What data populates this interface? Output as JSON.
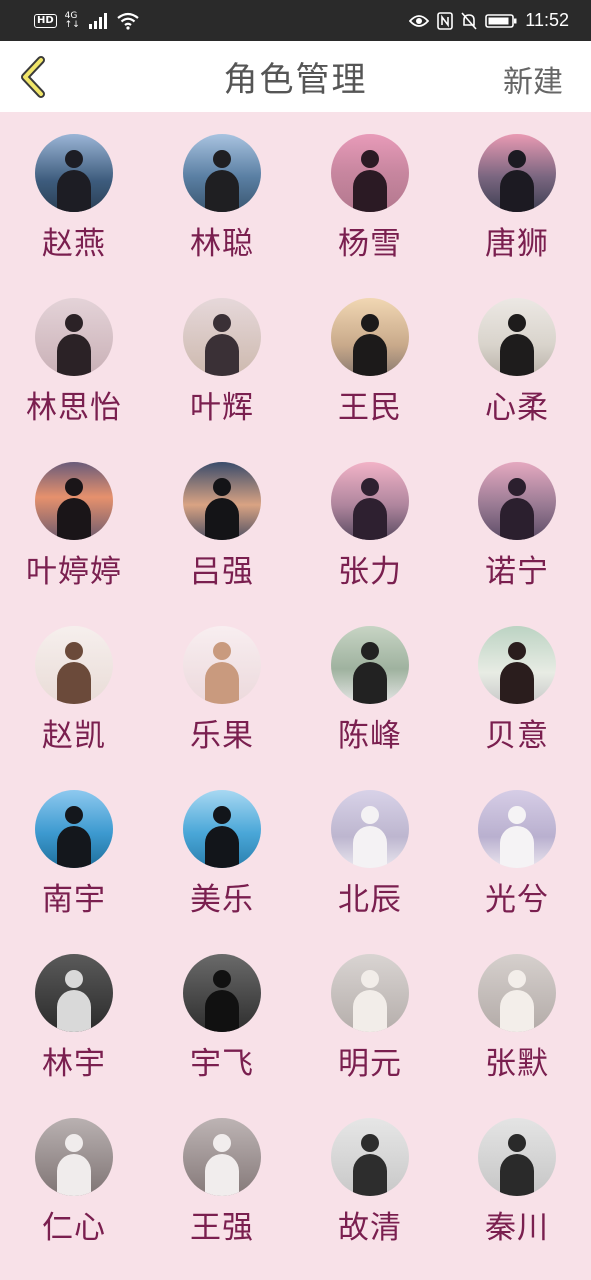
{
  "status_bar": {
    "left_badge": "HD",
    "network_top": "4G",
    "network_bottom": "↑↓",
    "time": "11:52"
  },
  "nav": {
    "title": "角色管理",
    "new_label": "新建"
  },
  "characters": [
    {
      "name": "赵燕",
      "bg": "linear-gradient(#9bb5d6,#3d5c7d 60%,#2b3f55)",
      "fg": "#1d1d24"
    },
    {
      "name": "林聪",
      "bg": "linear-gradient(#a9c3e0,#5a7fa3 55%,#3a5670)",
      "fg": "#1f1f22"
    },
    {
      "name": "杨雪",
      "bg": "linear-gradient(#e89bb9,#c7869f 50%,#b3788e)",
      "fg": "#2b1a24"
    },
    {
      "name": "唐狮",
      "bg": "linear-gradient(#e99ab3,#7a6680 55%,#3e3f52)",
      "fg": "#1c1a22"
    },
    {
      "name": "林思怡",
      "bg": "linear-gradient(#e4d3d8,#c9b0b6)",
      "fg": "#2b2226"
    },
    {
      "name": "叶辉",
      "bg": "linear-gradient(#e6d8da,#cdb9ae)",
      "fg": "#3a3036"
    },
    {
      "name": "王民",
      "bg": "linear-gradient(#f1d7b3,#c9aa8b 60%,#8a7a70)",
      "fg": "#1c1a1a"
    },
    {
      "name": "心柔",
      "bg": "linear-gradient(#ece8e4,#d9d4cc 60%,#b9b2a9)",
      "fg": "#1e1c1c"
    },
    {
      "name": "叶婷婷",
      "bg": "linear-gradient(#6a5b7a,#e6916d 45%,#6d5b6e)",
      "fg": "#1a1518"
    },
    {
      "name": "吕强",
      "bg": "linear-gradient(#3b4c6b,#d9a383 55%,#4d4f63)",
      "fg": "#141417"
    },
    {
      "name": "张力",
      "bg": "linear-gradient(#f2b3c7,#b0869e 55%,#5a4b61)",
      "fg": "#2e2030"
    },
    {
      "name": "诺宁",
      "bg": "linear-gradient(#e5a9c0,#9a7b94 55%,#5c4c66)",
      "fg": "#2b1f2e"
    },
    {
      "name": "赵凯",
      "bg": "linear-gradient(#f6efed,#e9dcd7)",
      "fg": "#6b4a3a"
    },
    {
      "name": "乐果",
      "bg": "linear-gradient(#f8eef0,#ecd9dc)",
      "fg": "#c99a7e"
    },
    {
      "name": "陈峰",
      "bg": "linear-gradient(#c7d4c4,#9fb29f 55%,#e6e6e6)",
      "fg": "#222222"
    },
    {
      "name": "贝意",
      "bg": "linear-gradient(#bcd3c3,#e8ece4 60%,#c9c9c9)",
      "fg": "#2a1d1d"
    },
    {
      "name": "南宇",
      "bg": "linear-gradient(#8ec9ef,#3d9ad0 55%,#1f6f9c)",
      "fg": "#14171c"
    },
    {
      "name": "美乐",
      "bg": "linear-gradient(#a8d8f2,#4aa7d8 55%,#2a7fae)",
      "fg": "#12151a"
    },
    {
      "name": "北辰",
      "bg": "linear-gradient(#d8d2e8,#bdb6cf 60%,#e9e6ee)",
      "fg": "#f4f2f4"
    },
    {
      "name": "光兮",
      "bg": "linear-gradient(#d6cde6,#b9b0cf 60%,#ebe6ee)",
      "fg": "#f5f3f5"
    },
    {
      "name": "林宇",
      "bg": "linear-gradient(#5a5a5a,#2b2b2b)",
      "fg": "#d9d9d9"
    },
    {
      "name": "宇飞",
      "bg": "linear-gradient(#6a6a6a,#2e2e2e)",
      "fg": "#111111"
    },
    {
      "name": "明元",
      "bg": "linear-gradient(#d9d4d2,#b5aeab)",
      "fg": "#f2ede9"
    },
    {
      "name": "张默",
      "bg": "linear-gradient(#d6d0cd,#b3aba8)",
      "fg": "#f3eeea"
    },
    {
      "name": "仁心",
      "bg": "linear-gradient(#b9b1b1,#7f7474)",
      "fg": "#f0ecec"
    },
    {
      "name": "王强",
      "bg": "linear-gradient(#bdb4b4,#857979)",
      "fg": "#f1eded"
    },
    {
      "name": "故清",
      "bg": "linear-gradient(#e6e6e6,#c8c8c8)",
      "fg": "#2d2d2d"
    },
    {
      "name": "秦川",
      "bg": "linear-gradient(#e4e4e4,#c6c6c6)",
      "fg": "#2a2a2a"
    }
  ]
}
